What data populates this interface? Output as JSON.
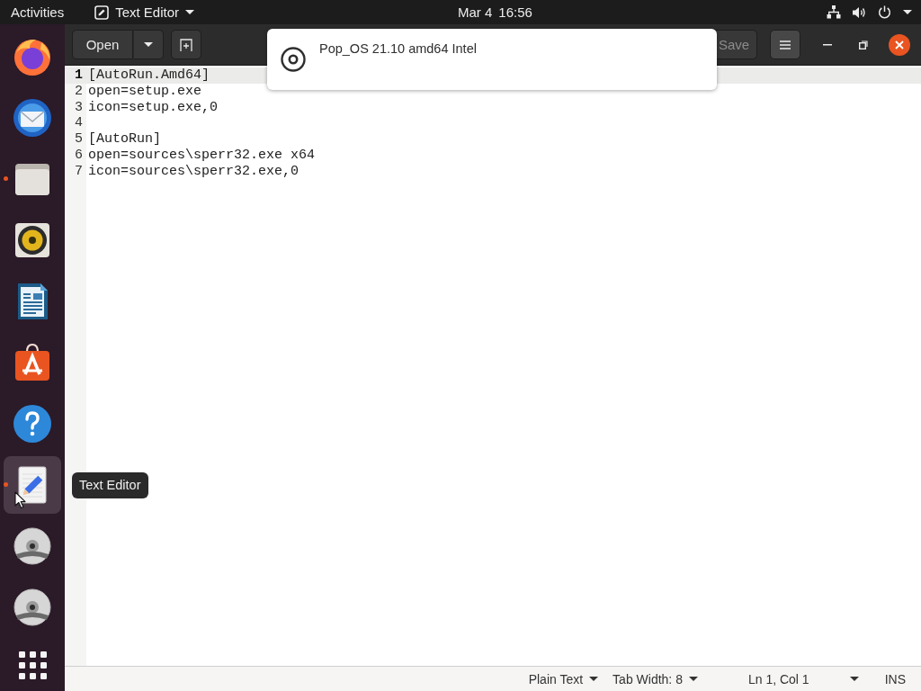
{
  "top_bar": {
    "activities": "Activities",
    "app_menu": "Text Editor",
    "date": "Mar 4",
    "time": "16:56"
  },
  "dock": {
    "items": [
      {
        "kind": "browser",
        "running": false,
        "hovered": false
      },
      {
        "kind": "mail",
        "running": false,
        "hovered": false
      },
      {
        "kind": "files",
        "running": true,
        "hovered": false
      },
      {
        "kind": "music",
        "running": false,
        "hovered": false
      },
      {
        "kind": "document",
        "running": false,
        "hovered": false
      },
      {
        "kind": "store",
        "running": false,
        "hovered": false
      },
      {
        "kind": "help",
        "running": false,
        "hovered": false
      },
      {
        "kind": "editor",
        "running": true,
        "hovered": true
      },
      {
        "kind": "disc",
        "running": false,
        "hovered": false
      },
      {
        "kind": "disc",
        "running": false,
        "hovered": false
      },
      {
        "kind": "apps",
        "running": false,
        "hovered": false
      }
    ]
  },
  "header_bar": {
    "open": "Open",
    "save": {
      "label": "Save",
      "disabled": true
    }
  },
  "notification": {
    "title": "Pop_OS 21.10 amd64 Intel"
  },
  "editor": {
    "lines": [
      {
        "number": "1",
        "text": "[AutoRun.Amd64]",
        "current": true
      },
      {
        "number": "2",
        "text": "open=setup.exe",
        "current": false
      },
      {
        "number": "3",
        "text": "icon=setup.exe,0",
        "current": false
      },
      {
        "number": "4",
        "current": false
      },
      {
        "number": "5",
        "text": "[AutoRun]",
        "current": false
      },
      {
        "number": "6",
        "text": "open=sources\\sperr32.exe x64",
        "current": false
      },
      {
        "number": "7",
        "text": "icon=sources\\sperr32.exe,0",
        "current": false
      }
    ]
  },
  "tooltip": "Text Editor",
  "status_bar": {
    "language": "Plain Text",
    "tab_width": "Tab Width: 8",
    "position": "Ln 1, Col 1",
    "mode": "INS"
  }
}
